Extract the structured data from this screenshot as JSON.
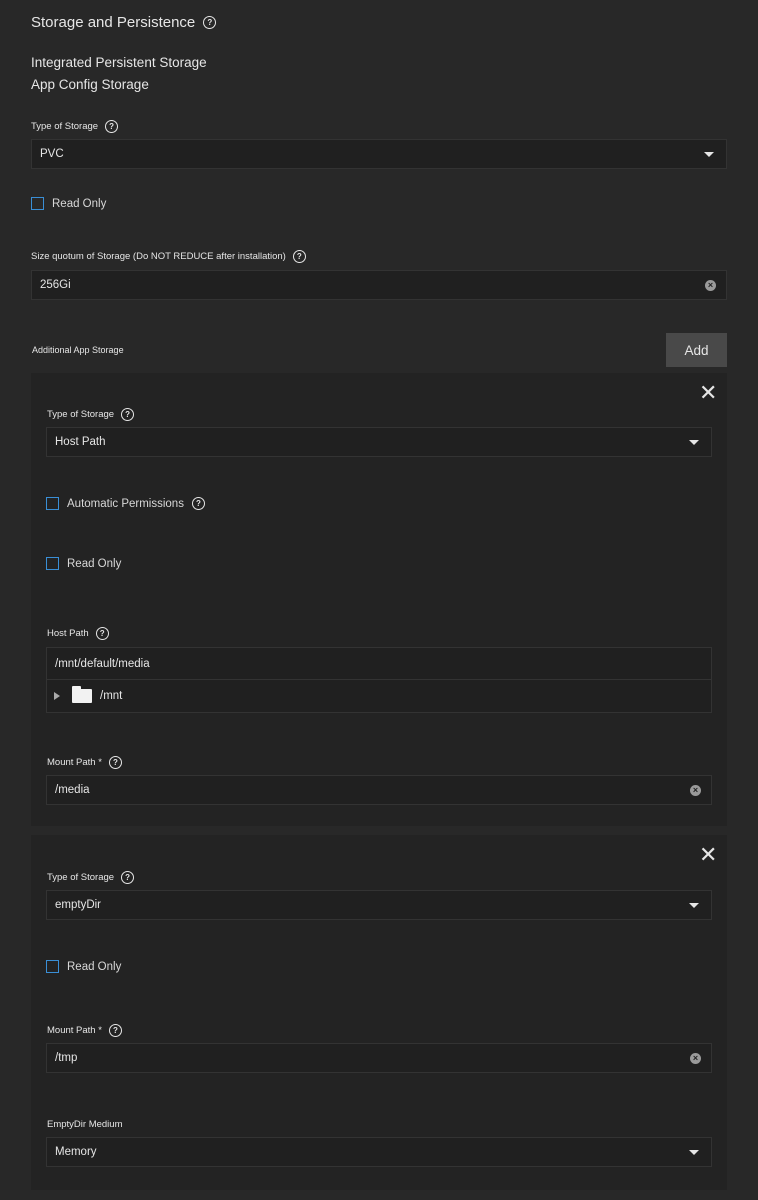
{
  "section": {
    "title": "Storage and Persistence"
  },
  "integrated": {
    "heading": "Integrated Persistent Storage",
    "subheading": "App Config Storage"
  },
  "config": {
    "type_label": "Type of Storage",
    "type_value": "PVC",
    "readonly_label": "Read Only",
    "size_label": "Size quotum of Storage (Do NOT REDUCE after installation)",
    "size_value": "256Gi"
  },
  "additional": {
    "label": "Additional App Storage",
    "add_label": "Add",
    "items": [
      {
        "type_label": "Type of Storage",
        "type_value": "Host Path",
        "auto_perm_label": "Automatic Permissions",
        "readonly_label": "Read Only",
        "hostpath_label": "Host Path",
        "hostpath_value": "/mnt/default/media",
        "tree_node": "/mnt",
        "mount_label": "Mount Path *",
        "mount_value": "/media"
      },
      {
        "type_label": "Type of Storage",
        "type_value": "emptyDir",
        "readonly_label": "Read Only",
        "mount_label": "Mount Path *",
        "mount_value": "/tmp",
        "medium_label": "EmptyDir Medium",
        "medium_value": "Memory"
      }
    ]
  },
  "icons": {
    "help": "help-circle-icon",
    "close": "close-icon",
    "dropdown": "caret-down-icon",
    "clear": "clear-icon",
    "folder": "folder-icon"
  },
  "colors": {
    "background": "#282828",
    "card": "#232323",
    "field": "#202020",
    "checkbox_border": "#3a8fd6",
    "button": "#494949"
  }
}
